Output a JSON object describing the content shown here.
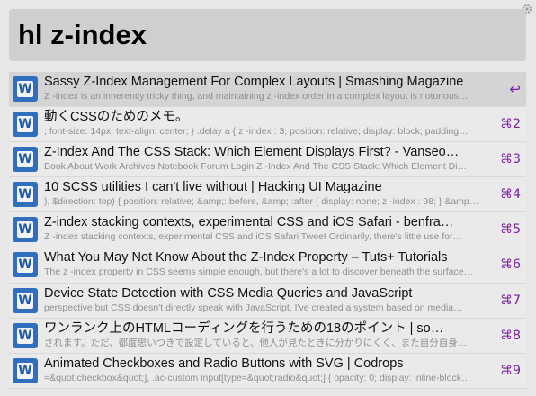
{
  "search": {
    "query": "hl z-index"
  },
  "results": [
    {
      "title": "Sassy Z-Index Management For Complex Layouts | Smashing Magazine",
      "snippet": "Z -index is an inherently tricky thing, and maintaining z -index order in a complex layout is notorious…",
      "shortcut": "↩",
      "selected": true
    },
    {
      "title": "動くCSSのためのメモ。",
      "snippet": "; font-size: 14px; text-align: center; } .delay a { z -index : 3; position: relative; display: block; padding…",
      "shortcut": "⌘2"
    },
    {
      "title": "Z-Index And The CSS Stack: Which Element Displays First? - Vanseo…",
      "snippet": "Book About Work Archives Notebook Forum Login Z -Index And The CSS Stack: Which Element Di…",
      "shortcut": "⌘3"
    },
    {
      "title": "10 SCSS utilities I can't live without | Hacking UI Magazine",
      "snippet": "), $direction: top) { position: relative; &amp;::before, &amp;::after { display: none; z -index : 98; } &amp…",
      "shortcut": "⌘4"
    },
    {
      "title": "Z-index stacking contexts, experimental CSS and iOS Safari - benfra…",
      "snippet": "Z -index stacking contexts, experimental CSS and iOS Safari  Tweet Ordinarily, there's little use for…",
      "shortcut": "⌘5"
    },
    {
      "title": "What You May Not Know About the Z-Index Property – Tuts+ Tutorials",
      "snippet": "The z -index property in CSS seems simple enough, but there's a lot to discover beneath the surface…",
      "shortcut": "⌘6"
    },
    {
      "title": "Device State Detection with CSS Media Queries and JavaScript",
      "snippet": " perspective but CSS doesn't directly speak with JavaScript. I've created a system based on media…",
      "shortcut": "⌘7"
    },
    {
      "title": "ワンランク上のHTMLコーディングを行うための18のポイント | so…",
      "snippet": "されます。ただ、都度思いつきで設定していると、他人が見たときに分かりにくく、また自分自身…",
      "shortcut": "⌘8"
    },
    {
      "title": "Animated Checkboxes and Radio Buttons with SVG | Codrops",
      "snippet": "=&quot;checkbox&quot;], .ac-custom input[type=&quot;radio&quot;] { opacity: 0; display: inline-block…",
      "shortcut": "⌘9"
    }
  ]
}
